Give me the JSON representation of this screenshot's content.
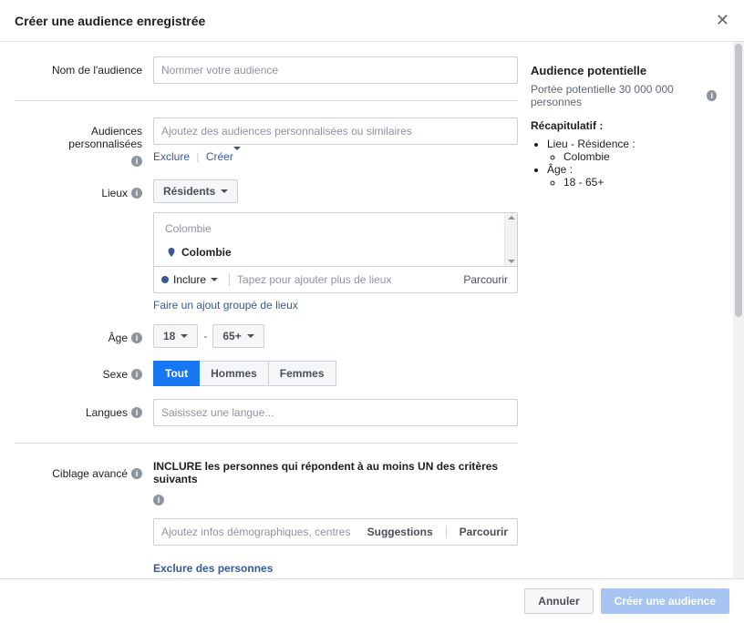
{
  "modal": {
    "title": "Créer une audience enregistrée"
  },
  "labels": {
    "audience_name": "Nom de l'audience",
    "custom_audiences": "Audiences personnalisées",
    "locations": "Lieux",
    "age": "Âge",
    "sex": "Sexe",
    "languages": "Langues",
    "advanced": "Ciblage avancé"
  },
  "placeholders": {
    "audience_name": "Nommer votre audience",
    "custom_audiences": "Ajoutez des audiences personnalisées ou similaires",
    "more_locations": "Tapez pour ajouter plus de lieux",
    "language": "Saisissez une langue...",
    "advanced": "Ajoutez infos démographiques, centres d'inté…"
  },
  "custom_audience_links": {
    "exclude": "Exclure",
    "create": "Créer"
  },
  "locations": {
    "residents_label": "Résidents",
    "country_header": "Colombie",
    "country_item": "Colombie",
    "include_label": "Inclure",
    "browse": "Parcourir",
    "bulk_link": "Faire un ajout groupé de lieux"
  },
  "age": {
    "from": "18",
    "to": "65+"
  },
  "sex": {
    "all": "Tout",
    "men": "Hommes",
    "women": "Femmes"
  },
  "advanced": {
    "heading": "INCLURE les personnes qui répondent à au moins UN des critères suivants",
    "suggestions": "Suggestions",
    "browse": "Parcourir",
    "exclude_link": "Exclure des personnes"
  },
  "summary": {
    "title": "Audience potentielle",
    "reach": "Portée potentielle 30 000 000 personnes",
    "recap_title": "Récapitulatif :",
    "loc_label": "Lieu - Résidence :",
    "loc_value": "Colombie",
    "age_label": "Âge :",
    "age_value": "18 - 65+"
  },
  "footer": {
    "cancel": "Annuler",
    "create": "Créer une audience"
  }
}
